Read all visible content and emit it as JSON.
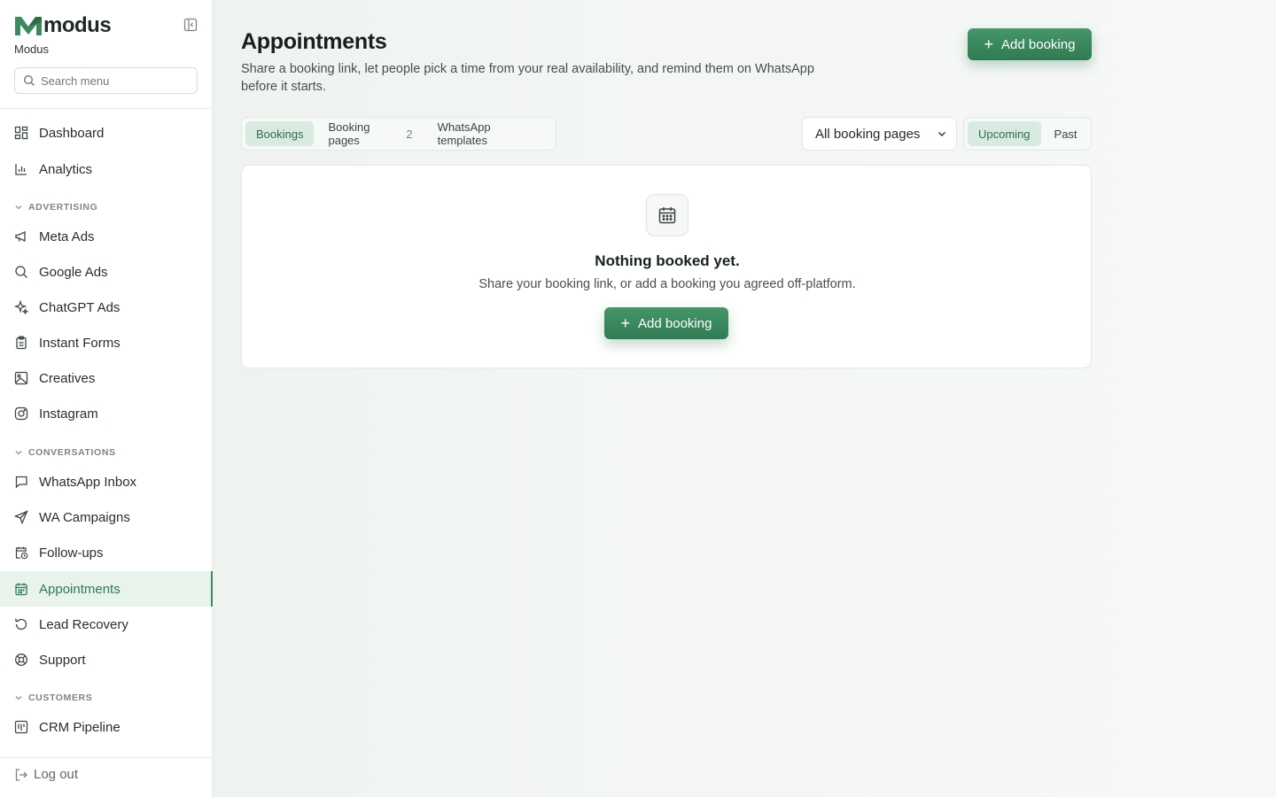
{
  "brand": {
    "wordmark": "modus",
    "workspace": "Modus",
    "accent": "#3b8a5e"
  },
  "search": {
    "placeholder": "Search menu",
    "value": ""
  },
  "sidebar": {
    "items_top": [
      {
        "label": "Dashboard",
        "icon": "dashboard-icon"
      },
      {
        "label": "Analytics",
        "icon": "bar-chart-icon"
      }
    ],
    "sections": [
      {
        "title": "ADVERTISING",
        "items": [
          {
            "label": "Meta Ads",
            "icon": "megaphone-icon"
          },
          {
            "label": "Google Ads",
            "icon": "search-icon"
          },
          {
            "label": "ChatGPT Ads",
            "icon": "sparkles-icon"
          },
          {
            "label": "Instant Forms",
            "icon": "clipboard-icon"
          },
          {
            "label": "Creatives",
            "icon": "image-icon"
          },
          {
            "label": "Instagram",
            "icon": "instagram-icon"
          }
        ]
      },
      {
        "title": "CONVERSATIONS",
        "items": [
          {
            "label": "WhatsApp Inbox",
            "icon": "message-icon"
          },
          {
            "label": "WA Campaigns",
            "icon": "send-icon"
          },
          {
            "label": "Follow-ups",
            "icon": "calendar-clock-icon"
          },
          {
            "label": "Appointments",
            "icon": "calendar-icon",
            "active": true
          },
          {
            "label": "Lead Recovery",
            "icon": "rotate-ccw-icon"
          },
          {
            "label": "Support",
            "icon": "lifebuoy-icon"
          }
        ]
      },
      {
        "title": "CUSTOMERS",
        "items": [
          {
            "label": "CRM Pipeline",
            "icon": "kanban-icon"
          }
        ]
      }
    ],
    "logout": "Log out"
  },
  "page": {
    "title": "Appointments",
    "subtitle": "Share a booking link, let people pick a time from your real availability, and remind them on WhatsApp before it starts.",
    "add_button": "Add booking"
  },
  "tabs": [
    {
      "label": "Bookings",
      "active": true
    },
    {
      "label": "Booking pages",
      "count": "2"
    },
    {
      "label": "WhatsApp templates"
    }
  ],
  "filter": {
    "selected": "All booking pages"
  },
  "time_filter": [
    {
      "label": "Upcoming",
      "active": true
    },
    {
      "label": "Past"
    }
  ],
  "empty_state": {
    "icon": "calendar-icon",
    "title": "Nothing booked yet.",
    "description": "Share your booking link, or add a booking you agreed off-platform.",
    "button": "Add booking"
  }
}
